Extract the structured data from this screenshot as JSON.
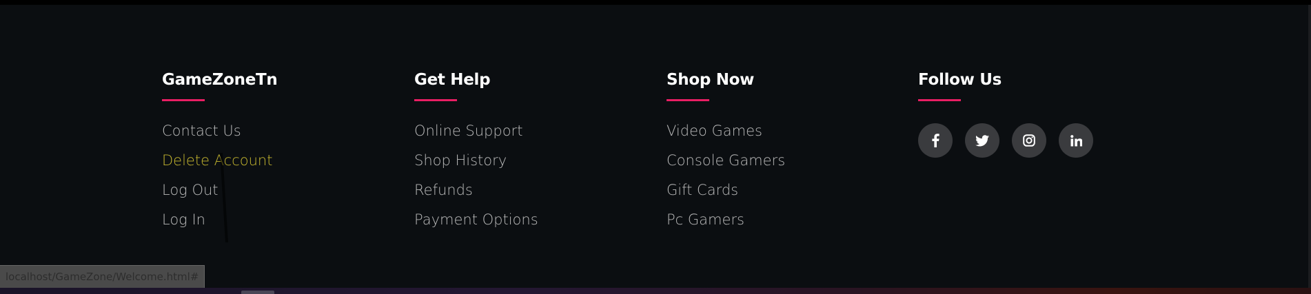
{
  "footer": {
    "columns": [
      {
        "title": "GameZoneTn",
        "links": [
          "Contact Us",
          "Delete Account",
          "Log Out",
          "Log In"
        ]
      },
      {
        "title": "Get Help",
        "links": [
          "Online Support",
          "Shop History",
          "Refunds",
          "Payment Options"
        ]
      },
      {
        "title": "Shop Now",
        "links": [
          "Video Games",
          "Console Gamers",
          "Gift Cards",
          "Pc Gamers"
        ]
      }
    ],
    "follow": {
      "title": "Follow Us",
      "icons": [
        "facebook-icon",
        "twitter-icon",
        "instagram-icon",
        "linkedin-icon"
      ]
    },
    "hovered_link": "Delete Account"
  },
  "status_bar": {
    "url": "localhost/GameZone/Welcome.html#"
  },
  "colors": {
    "background": "#0b0e11",
    "accent_underline": "#e91e63",
    "link_text": "#bbbbbb",
    "hover_link_text": "#c5b62f",
    "social_circle": "#3a3b3e"
  }
}
